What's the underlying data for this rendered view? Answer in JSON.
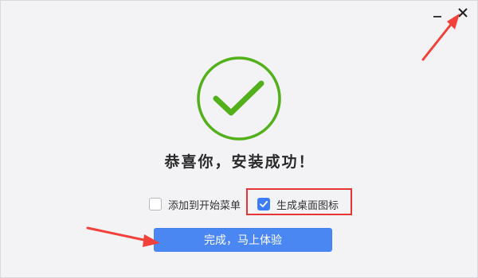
{
  "window": {
    "controls": {
      "minimize_icon": "minimize-icon",
      "close_icon": "close-icon"
    }
  },
  "main": {
    "success_icon": "check-circle-icon",
    "title": "恭喜你，安装成功！"
  },
  "options": [
    {
      "label": "添加到开始菜单",
      "checked": false
    },
    {
      "label": "生成桌面图标",
      "checked": true
    }
  ],
  "primary_button": {
    "label": "完成，马上体验"
  },
  "colors": {
    "background": "#f3f2f5",
    "success_green": "#52b01a",
    "accent_blue": "#4b87f3",
    "annotation_red": "#e53535"
  }
}
